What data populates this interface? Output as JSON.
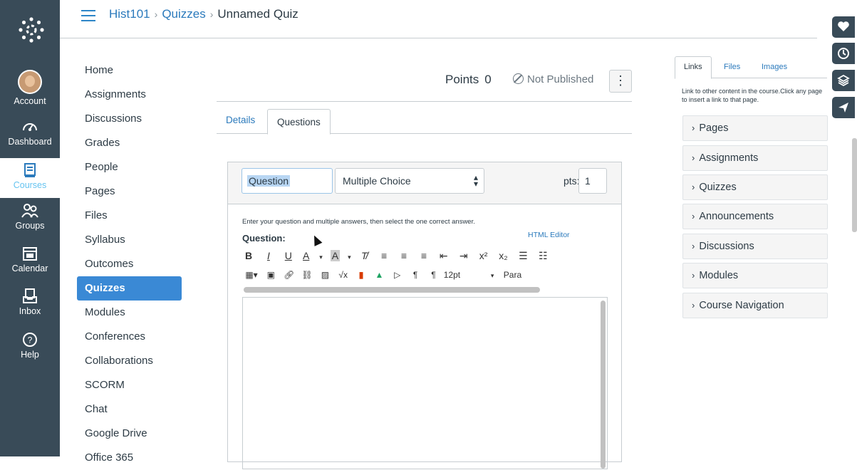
{
  "global_nav": {
    "items": [
      {
        "label": "Account",
        "icon": "avatar"
      },
      {
        "label": "Dashboard",
        "icon": "dashboard-icon"
      },
      {
        "label": "Courses",
        "icon": "book-icon",
        "active": true
      },
      {
        "label": "Groups",
        "icon": "groups-icon"
      },
      {
        "label": "Calendar",
        "icon": "calendar-icon"
      },
      {
        "label": "Inbox",
        "icon": "inbox-icon"
      },
      {
        "label": "Help",
        "icon": "help-icon"
      }
    ]
  },
  "breadcrumb": {
    "course": "Hist101",
    "section": "Quizzes",
    "current": "Unnamed Quiz"
  },
  "course_nav": {
    "items": [
      "Home",
      "Assignments",
      "Discussions",
      "Grades",
      "People",
      "Pages",
      "Files",
      "Syllabus",
      "Outcomes",
      "Quizzes",
      "Modules",
      "Conferences",
      "Collaborations",
      "SCORM",
      "Chat",
      "Google Drive",
      "Office 365"
    ],
    "active": "Quizzes"
  },
  "header": {
    "points_label": "Points",
    "points_value": "0",
    "publish_status": "Not Published",
    "more_label": "⋮"
  },
  "tabs": {
    "details": "Details",
    "questions": "Questions"
  },
  "question": {
    "name": "Question",
    "type": "Multiple Choice",
    "pts_label": "pts:",
    "pts_value": "1",
    "instructions": "Enter your question and multiple answers, then select the one correct answer.",
    "label": "Question:",
    "html_editor": "HTML Editor",
    "font_size": "12pt",
    "paragraph": "Para"
  },
  "right_panel": {
    "tabs": [
      "Links",
      "Files",
      "Images"
    ],
    "description": "Link to other content in the course.Click any page to insert a link to that page.",
    "sections": [
      "Pages",
      "Assignments",
      "Quizzes",
      "Announcements",
      "Discussions",
      "Modules",
      "Course Navigation"
    ]
  },
  "colors": {
    "nav_bg": "#394b58",
    "active_blue": "#3a89d5",
    "link_blue": "#2b7abc"
  }
}
